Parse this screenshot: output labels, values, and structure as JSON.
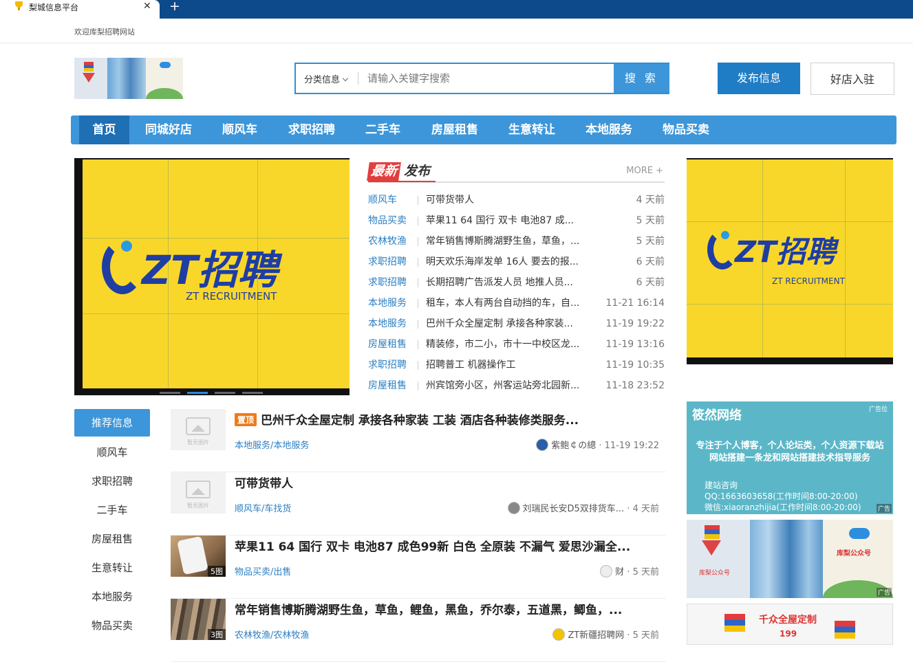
{
  "browser": {
    "tab_title": "梨城信息平台",
    "new_tab": "+",
    "close": "✕"
  },
  "header": {
    "welcome": "欢迎库梨招聘网站",
    "search": {
      "category": "分类信息",
      "placeholder": "请输入关键字搜索",
      "button": "搜 索"
    },
    "publish_button": "发布信息",
    "join_button": "好店入驻"
  },
  "nav": {
    "items": [
      "首页",
      "同城好店",
      "顺风车",
      "求职招聘",
      "二手车",
      "房屋租售",
      "生意转让",
      "本地服务",
      "物品买卖"
    ],
    "active": 0
  },
  "banner": {
    "logo_text": "ZT招聘",
    "logo_sub": "ZT RECRUITMENT",
    "slides": 4,
    "active_slide": 1
  },
  "latest": {
    "title_highlight": "最新",
    "title_rest": "发布",
    "more": "MORE +",
    "rows": [
      {
        "cat": "顺风车",
        "text": "可带货带人",
        "time": "4 天前"
      },
      {
        "cat": "物品买卖",
        "text": "苹果11 64 国行 双卡 电池87 成...",
        "time": "5 天前"
      },
      {
        "cat": "农林牧渔",
        "text": "常年销售博斯腾湖野生鱼，草鱼，...",
        "time": "5 天前"
      },
      {
        "cat": "求职招聘",
        "text": "明天欢乐海岸发单 16人 要去的报...",
        "time": "6 天前"
      },
      {
        "cat": "求职招聘",
        "text": "长期招聘广告派发人员 地推人员...",
        "time": "6 天前"
      },
      {
        "cat": "本地服务",
        "text": "租车，本人有两台自动挡的车，自...",
        "time": "11-21 16:14"
      },
      {
        "cat": "本地服务",
        "text": "巴州千众全屋定制 承接各种家装...",
        "time": "11-19 19:22"
      },
      {
        "cat": "房屋租售",
        "text": "精装修，市二小，市十一中校区龙...",
        "time": "11-19 13:16"
      },
      {
        "cat": "求职招聘",
        "text": "招聘普工 机器操作工",
        "time": "11-19 10:35"
      },
      {
        "cat": "房屋租售",
        "text": "州宾馆旁小区，州客运站旁北园新...",
        "time": "11-18 23:52"
      }
    ]
  },
  "sidebar": {
    "items": [
      "推荐信息",
      "顺风车",
      "求职招聘",
      "二手车",
      "房屋租售",
      "生意转让",
      "本地服务",
      "物品买卖"
    ],
    "active": 0
  },
  "feed": {
    "no_image_label": "暂无图片",
    "cards": [
      {
        "badge": "置顶",
        "title": "巴州千众全屋定制 承接各种家装 工装 酒店各种装修类服务...",
        "cat": "本地服务/本地服务",
        "author": "紫鲍￠の總",
        "time": "11-19 19:22",
        "image": "none",
        "count": ""
      },
      {
        "badge": "",
        "title": "可带货带人",
        "cat": "顺风车/车找货",
        "author": "刘瑞民长安D5双排货车...",
        "time": "4 天前",
        "image": "none",
        "count": ""
      },
      {
        "badge": "",
        "title": "苹果11 64 国行 双卡 电池87 成色99新 白色 全原装 不漏气 爱思沙漏全...",
        "cat": "物品买卖/出售",
        "author": "财",
        "time": "5 天前",
        "image": "phone",
        "count": "5图"
      },
      {
        "badge": "",
        "title": "常年销售博斯腾湖野生鱼，草鱼，鲤鱼，黑鱼，乔尔泰，五道黑，鲫鱼，...",
        "cat": "农林牧渔/农林牧渔",
        "author": "ZT新疆招聘网",
        "time": "5 天前",
        "image": "fish",
        "count": "3图"
      }
    ],
    "separator": " · "
  },
  "ads": {
    "ad1": {
      "name": "筱然网络",
      "tag": "广告位",
      "desc_line1": "专注于个人博客，个人论坛类，个人资源下载站",
      "desc_line2": "网站搭建一条龙和网站搭建技术指导服务",
      "contact_title": "建站咨询",
      "contact_qq": "QQ:1663603658(工作时间8:00-20:00)",
      "contact_wx": "微信:xiaoranzhijia(工作时间8:00-20:00)",
      "label": "广告"
    },
    "ad2": {
      "left_label": "库梨公众号",
      "right_label": "库梨公众号",
      "label": "广告"
    },
    "ad3": {
      "title": "千众全屋定制",
      "price": "199"
    }
  },
  "colors": {
    "brand": "#3d96d9",
    "brand_dark": "#1f6fb5",
    "link": "#2b7fc3",
    "banner_yellow": "#f9d72a",
    "zt_blue": "#1f3ea3"
  }
}
